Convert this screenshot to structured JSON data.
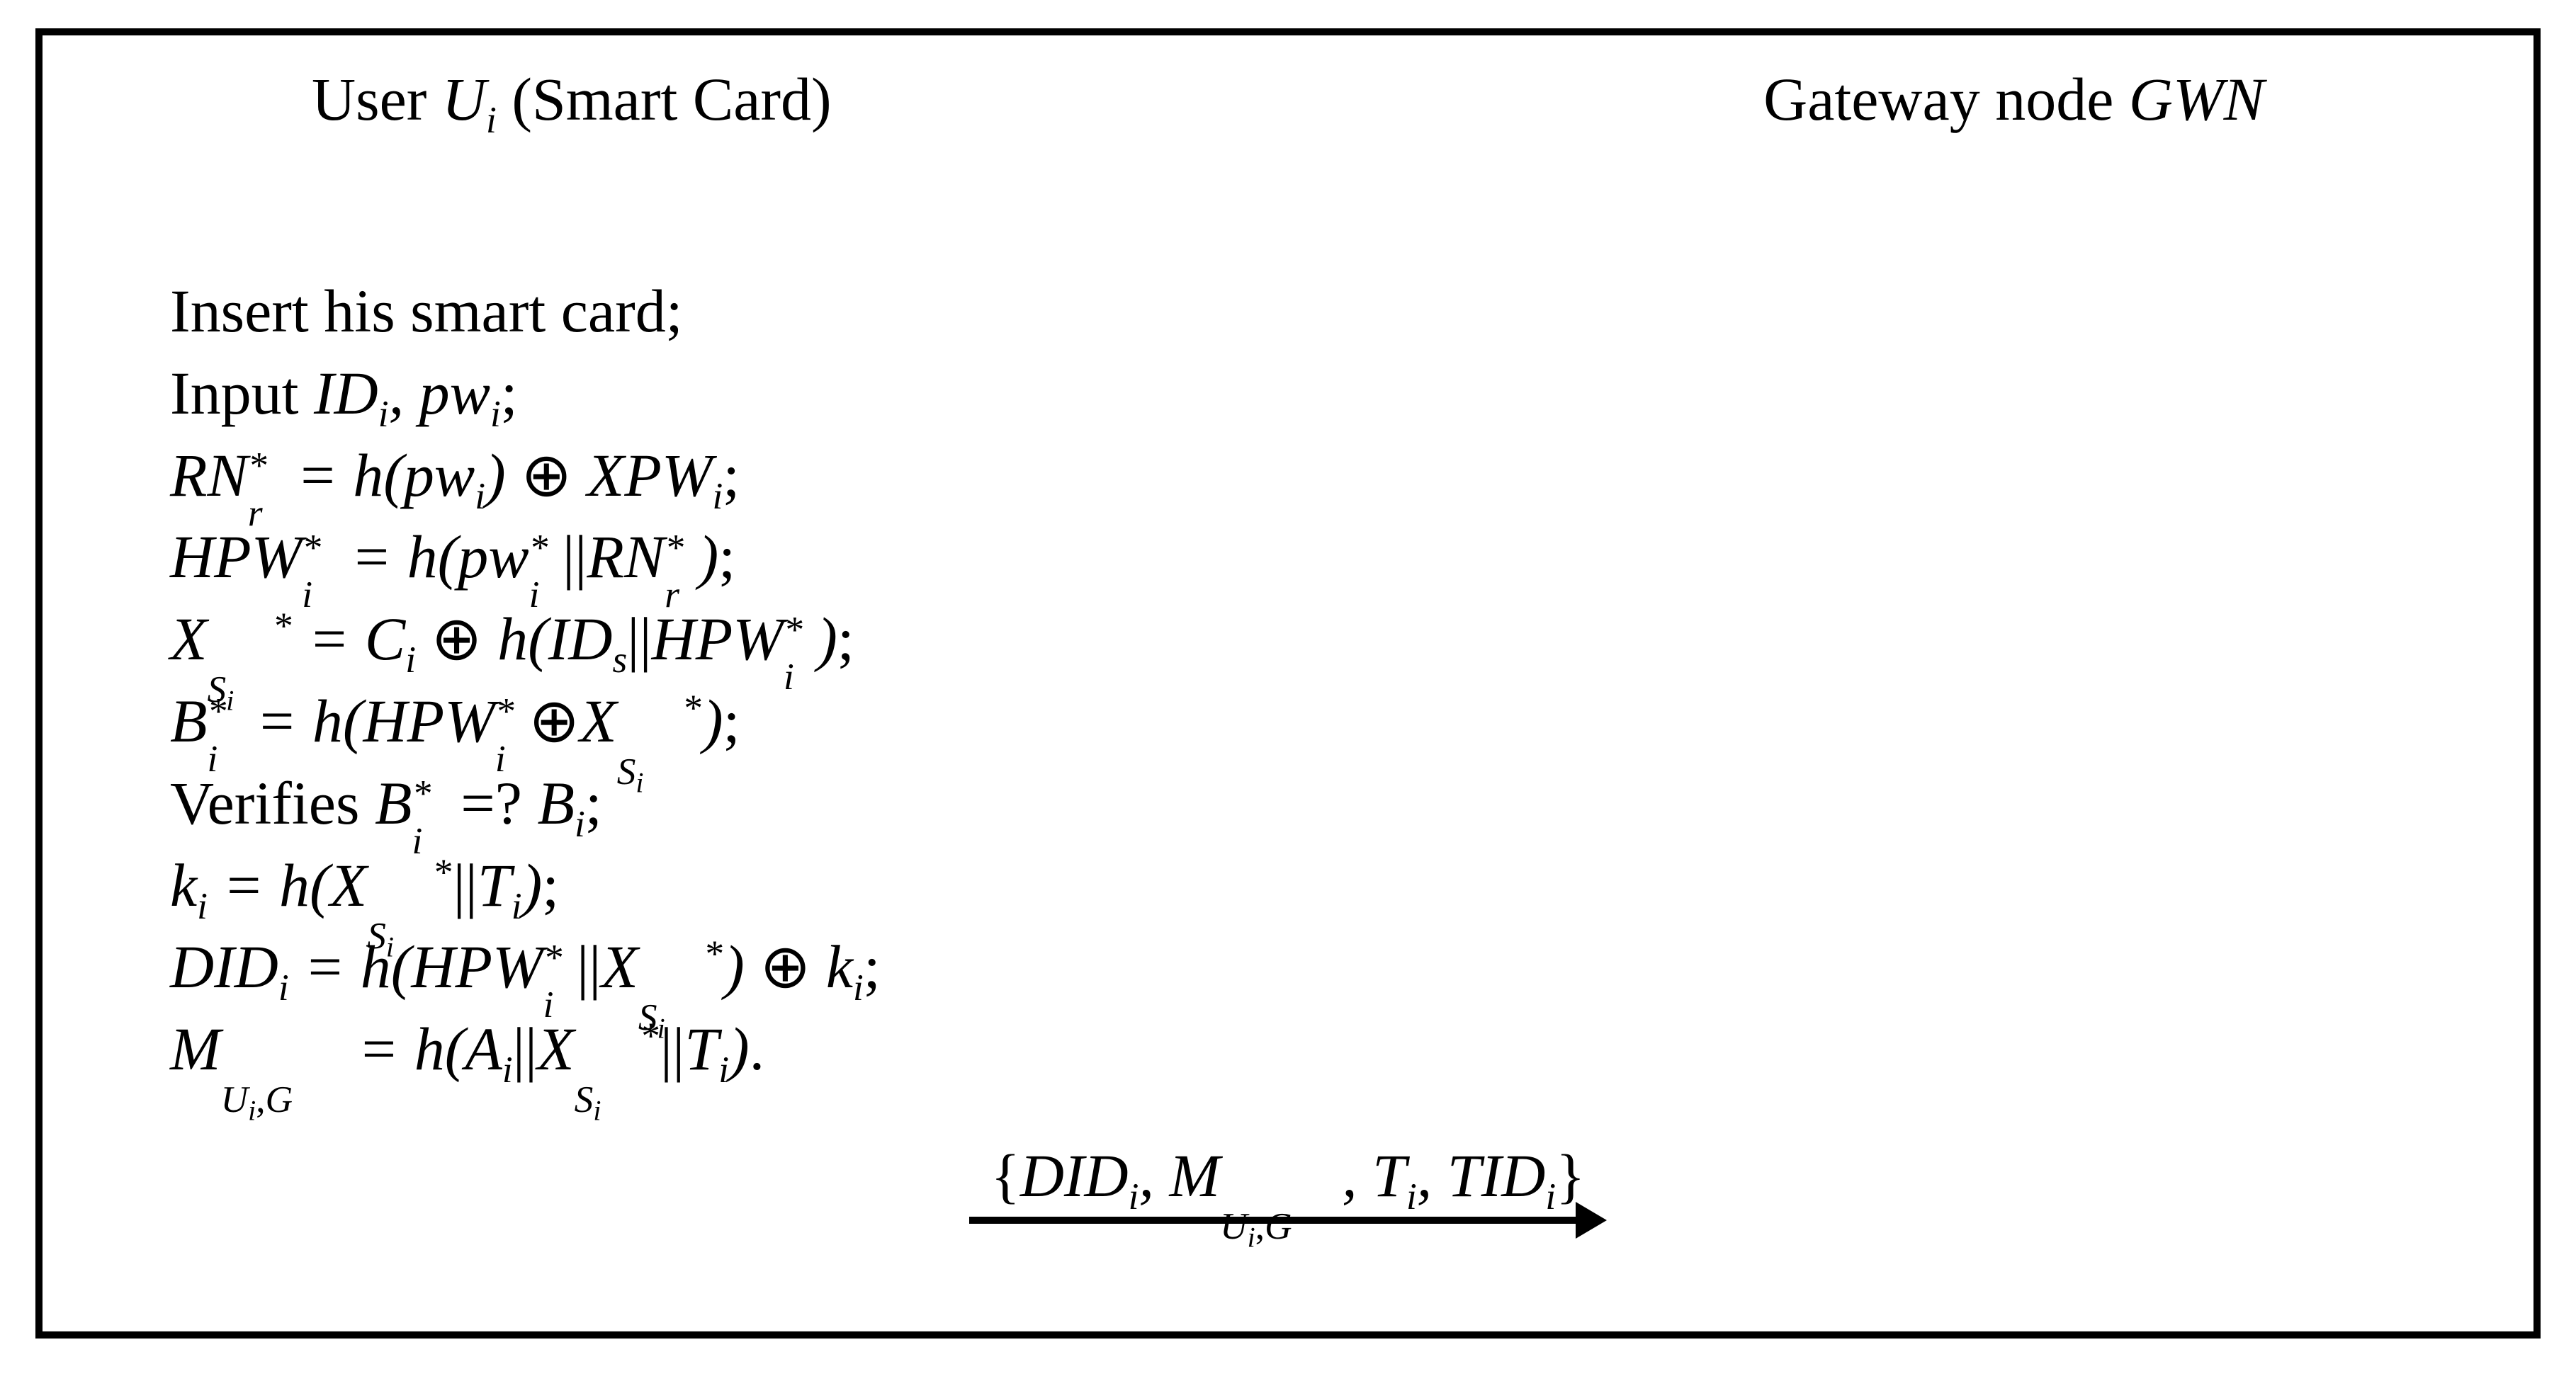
{
  "headings": {
    "user_prefix": "User ",
    "user_symbol_base": "U",
    "user_symbol_sub": "i",
    "user_suffix": " (Smart Card)",
    "gwn_prefix": "Gateway node ",
    "gwn_symbol": "GWN"
  },
  "steps": {
    "s1_text": "Insert his smart card;",
    "s2_prefix": "Input ",
    "s2_id_base": "ID",
    "s2_id_sub": "i",
    "s2_mid": ", ",
    "s2_pw_base": "pw",
    "s2_pw_sub": "i",
    "s2_end": ";",
    "s3_lhs_base": "RN",
    "s3_lhs_sub": "r",
    "s3_lhs_sup": "*",
    "eq": " = ",
    "s3_h": "h",
    "lpar": "(",
    "rpar": ")",
    "s3_pw_base": "pw",
    "s3_pw_sub": "i",
    "xor": " ⊕ ",
    "s3_xpw_base": "XPW",
    "s3_xpw_sub": "i",
    "semic": ";",
    "s4_lhs_base": "HPW",
    "s4_lhs_sub": "i",
    "s4_lhs_sup": "*",
    "s4_pw_base": "pw",
    "s4_pw_sub": "i",
    "s4_pw_sup": "*",
    "concat": "||",
    "s4_rn_base": "RN",
    "s4_rn_sub": "r",
    "s4_rn_sup": "*",
    "s5_lhs_base": "X",
    "s5_lhs_outer": "S",
    "s5_lhs_inner": "i",
    "s5_lhs_sup": "*",
    "s5_c_base": "C",
    "s5_c_sub": "i",
    "s5_id_base": "ID",
    "s5_id_sub": "s",
    "s5_hpw_base": "HPW",
    "s5_hpw_sub": "i",
    "s5_hpw_sup": "*",
    "s6_lhs_base": "B",
    "s6_lhs_sub": "i",
    "s6_lhs_sup": "*",
    "s6_hpw_base": "HPW",
    "s6_hpw_sub": "i",
    "s6_hpw_sup": "*",
    "xor_tight": "⊕",
    "s6_x_base": "X",
    "s6_x_outer": "S",
    "s6_x_inner": "i",
    "s6_x_sup": "*",
    "s7_prefix": "Verifies ",
    "s7_l_base": "B",
    "s7_l_sub": "i",
    "s7_l_sup": "*",
    "s7_eqq": " =? ",
    "s7_r_base": "B",
    "s7_r_sub": "i",
    "s8_lhs_base": "k",
    "s8_lhs_sub": "i",
    "s8_x_base": "X",
    "s8_x_outer": "S",
    "s8_x_inner": "i",
    "s8_x_sup": "*",
    "s8_t_base": "T",
    "s8_t_sub": "i",
    "s9_lhs_base": "DID",
    "s9_lhs_sub": "i",
    "s9_hpw_base": "HPW",
    "s9_hpw_sub": "i",
    "s9_hpw_sup": "*",
    "s9_x_base": "X",
    "s9_x_outer": "S",
    "s9_x_inner": "i",
    "s9_x_sup": "*",
    "s9_k_base": "k",
    "s9_k_sub": "i",
    "s10_lhs_base": "M",
    "s10_lhs_outer1": "U",
    "s10_lhs_inner1": "i",
    "s10_lhs_comma": ",",
    "s10_lhs_outer2": "G",
    "s10_a_base": "A",
    "s10_a_sub": "i",
    "s10_x_base": "X",
    "s10_x_outer": "S",
    "s10_x_inner": "i",
    "s10_x_sup": "*",
    "s10_t_base": "T",
    "s10_t_sub": "i",
    "period": "."
  },
  "message": {
    "lbrace": "{",
    "did_base": "DID",
    "did_sub": "i",
    "comma": ", ",
    "m_base": "M",
    "m_outer1": "U",
    "m_inner1": "i",
    "m_comma": ",",
    "m_outer2": "G",
    "t_base": "T",
    "t_sub": "i",
    "tid_base": "TID",
    "tid_sub": "i",
    "rbrace": "}"
  }
}
